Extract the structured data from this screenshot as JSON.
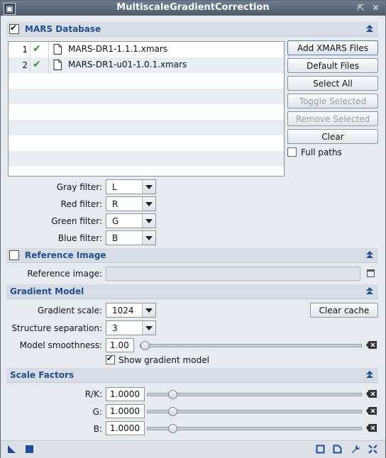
{
  "window": {
    "title": "MultiscaleGradientCorrection"
  },
  "mars": {
    "section_title": "MARS Database",
    "checked": true,
    "files": [
      {
        "index": "1",
        "name": "MARS-DR1-1.1.1.xmars",
        "enabled": true
      },
      {
        "index": "2",
        "name": "MARS-DR1-u01-1.0.1.xmars",
        "enabled": true
      }
    ],
    "buttons": {
      "add": "Add XMARS Files",
      "default": "Default Files",
      "select_all": "Select All",
      "toggle": "Toggle Selected",
      "remove": "Remove Selected",
      "clear": "Clear"
    },
    "full_paths_label": "Full paths",
    "full_paths_checked": false,
    "filters": [
      {
        "label": "Gray filter:",
        "value": "L"
      },
      {
        "label": "Red filter:",
        "value": "R"
      },
      {
        "label": "Green filter:",
        "value": "G"
      },
      {
        "label": "Blue filter:",
        "value": "B"
      }
    ]
  },
  "reference": {
    "section_title": "Reference Image",
    "checked": false,
    "field_label": "Reference image:",
    "value": ""
  },
  "gradient": {
    "section_title": "Gradient Model",
    "scale_label": "Gradient scale:",
    "scale_value": "1024",
    "separation_label": "Structure separation:",
    "separation_value": "3",
    "smoothness_label": "Model smoothness:",
    "smoothness_value": "1.00",
    "smoothness_slider": 0.0,
    "clear_cache": "Clear cache",
    "show_model_label": "Show gradient model",
    "show_model_checked": true
  },
  "scale": {
    "section_title": "Scale Factors",
    "factors": [
      {
        "label": "R/K:",
        "value": "1.0000",
        "slider": 0.1
      },
      {
        "label": "G:",
        "value": "1.0000",
        "slider": 0.1
      },
      {
        "label": "B:",
        "value": "1.0000",
        "slider": 0.1
      }
    ]
  },
  "colors": {
    "accent": "#1f4f94",
    "check": "#2a9c2a",
    "title_bar": "#5a6578"
  },
  "icons": [
    "window-icon",
    "shade-icon",
    "close-icon",
    "collapse-arrow-icon",
    "file-icon",
    "checkmark-icon",
    "clear-field-icon",
    "new-instance-icon",
    "apply-square-icon",
    "preview-icon",
    "real-time-preview-icon",
    "wrench-icon",
    "reset-icon",
    "expand-icon"
  ]
}
